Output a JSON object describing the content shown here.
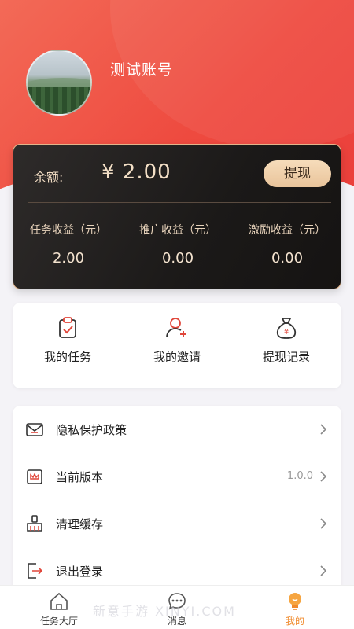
{
  "profile": {
    "username": "测试账号"
  },
  "wallet": {
    "balance_label": "余额:",
    "balance_amount": "¥ 2.00",
    "withdraw_label": "提现",
    "stats": [
      {
        "label": "任务收益（元）",
        "value": "2.00"
      },
      {
        "label": "推广收益（元）",
        "value": "0.00"
      },
      {
        "label": "激励收益（元）",
        "value": "0.00"
      }
    ]
  },
  "quick_actions": [
    {
      "label": "我的任务",
      "icon": "clipboard-check-icon"
    },
    {
      "label": "我的邀请",
      "icon": "add-user-icon"
    },
    {
      "label": "提现记录",
      "icon": "money-bag-icon"
    }
  ],
  "menu": [
    {
      "label": "隐私保护政策",
      "value": "",
      "icon": "envelope-icon"
    },
    {
      "label": "当前版本",
      "value": "1.0.0",
      "icon": "crown-box-icon"
    },
    {
      "label": "清理缓存",
      "value": "",
      "icon": "broom-icon"
    },
    {
      "label": "退出登录",
      "value": "",
      "icon": "logout-icon"
    }
  ],
  "tabs": [
    {
      "label": "任务大厅",
      "icon": "home-icon",
      "active": false
    },
    {
      "label": "消息",
      "icon": "chat-icon",
      "active": false
    },
    {
      "label": "我的",
      "icon": "bulb-icon",
      "active": true
    }
  ],
  "watermark": "新意手游 XINYI.COM",
  "colors": {
    "header_red": "#ee4a3f",
    "gold_text": "#f1dcc3",
    "icon_red": "#e0463a",
    "active_tab": "#f08a2c"
  }
}
